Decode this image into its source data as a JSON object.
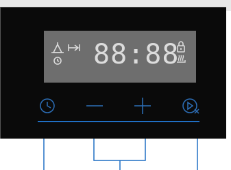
{
  "display": {
    "time": "88:88",
    "icons": [
      "bell-icon",
      "timer-end-icon",
      "clock-small-icon",
      "lock-icon",
      "steam-icon"
    ]
  },
  "controls": {
    "clock": {
      "icon": "clock-icon"
    },
    "minus": {
      "icon": "minus-icon"
    },
    "plus": {
      "icon": "plus-icon"
    },
    "play_cancel": {
      "icon": "play-cancel-icon"
    }
  },
  "colors": {
    "panel": "#0a0a0a",
    "display": "#6e6e6e",
    "segment": "#dcdcdc",
    "accent": "#1f6fc4"
  }
}
